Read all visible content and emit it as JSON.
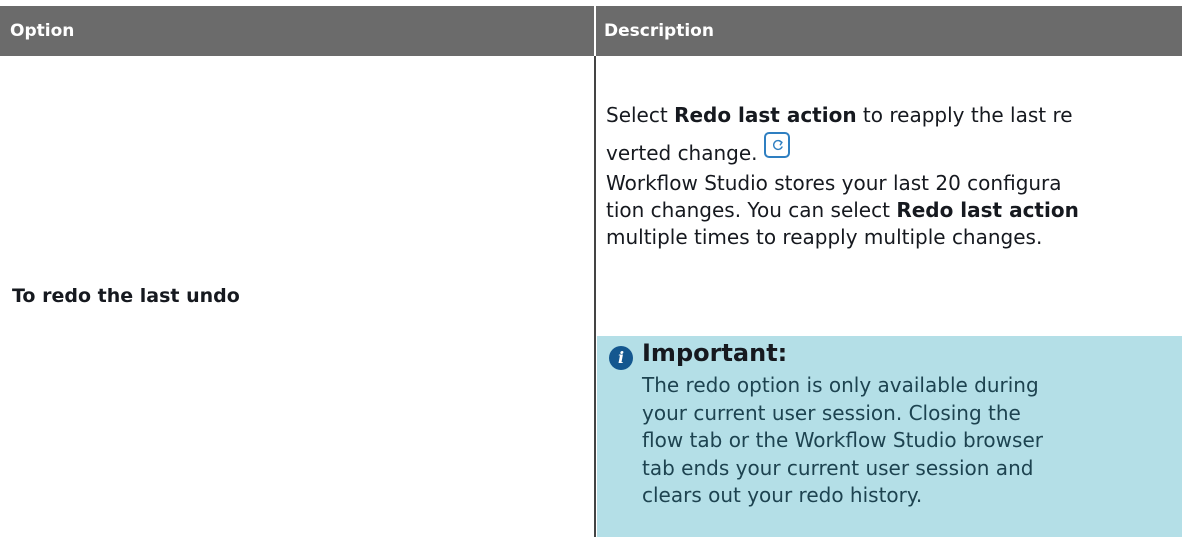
{
  "header": {
    "option_label": "Option",
    "description_label": "Description"
  },
  "row": {
    "option": "To redo the last undo",
    "p1_before": "Select ",
    "p1_bold": "Redo last action",
    "p1_after_line1": " to reapply the last re",
    "p1_line2": "verted change. ",
    "redo_icon": "redo-icon",
    "p2_line1": "Workflow Studio stores your last 20 configura",
    "p2_line2_before": "tion changes. You can select ",
    "p2_line2_bold": "Redo last action",
    "p2_line3": "multiple times to reapply multiple changes.",
    "important": {
      "icon": "info-icon",
      "title": "Important:",
      "lines": [
        "The redo option is only available during",
        "your current user session. Closing the",
        "flow tab or the Workflow Studio browser",
        "tab ends your current user session and",
        "clears out your redo history."
      ]
    }
  },
  "colors": {
    "header_bg": "#6b6b6b",
    "note_bg": "#b4dfe7",
    "info_icon": "#14578f",
    "redo_icon_border": "#2f7fc1"
  }
}
